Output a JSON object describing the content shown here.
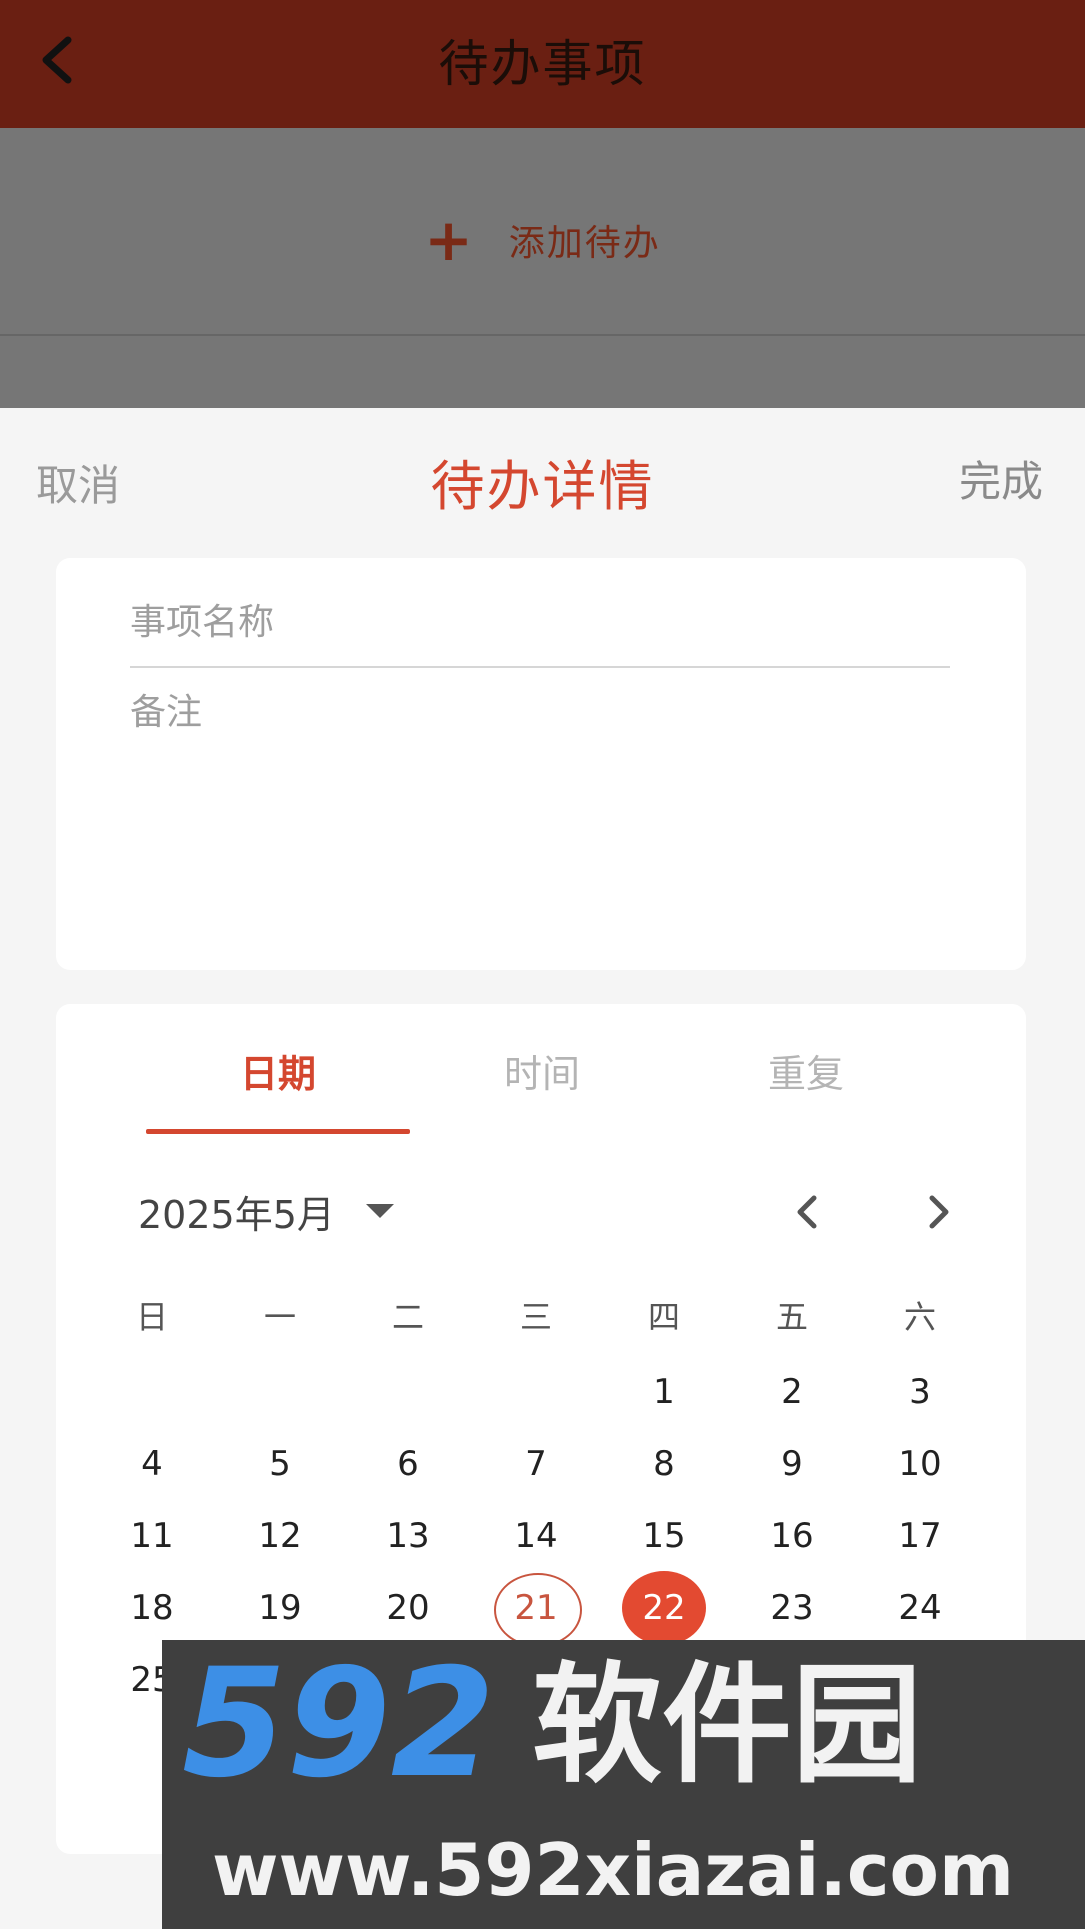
{
  "header": {
    "title": "待办事项"
  },
  "add_todo": {
    "plus": "+",
    "label": "添加待办"
  },
  "sheet": {
    "cancel": "取消",
    "title": "待办详情",
    "done": "完成"
  },
  "form": {
    "name_placeholder": "事项名称",
    "note_placeholder": "备注"
  },
  "calendar": {
    "tabs": [
      "日期",
      "时间",
      "重复"
    ],
    "active_tab": 0,
    "month_label": "2025年5月",
    "weekdays": [
      "日",
      "一",
      "二",
      "三",
      "四",
      "五",
      "六"
    ],
    "first_weekday_index": 4,
    "days_in_month": 31,
    "today": 21,
    "selected": 22,
    "visible_rows": 5
  },
  "watermark": {
    "brand_number": "592",
    "brand_text": "软件园",
    "url": "www.592xiazai.com"
  },
  "colors": {
    "header_bg": "#6a1f12",
    "accent": "#d4472f",
    "selected_bg": "#e34a31",
    "overlay": "#767676"
  }
}
